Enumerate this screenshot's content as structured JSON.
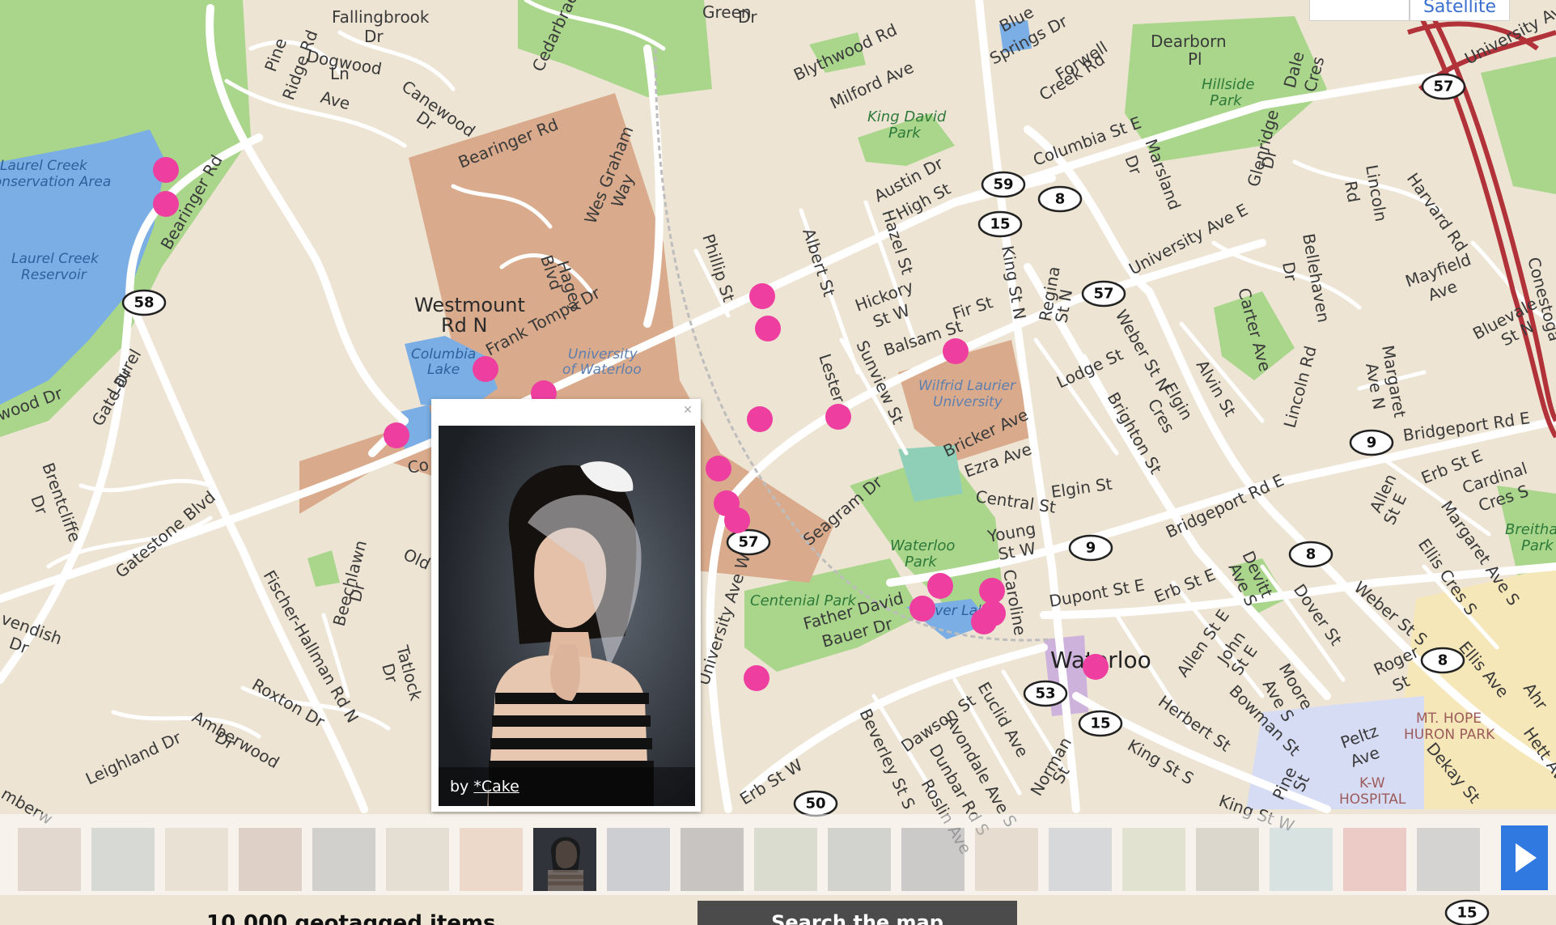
{
  "map_toggle": {
    "map_label": "",
    "satellite_label": "Satellite"
  },
  "streets": {
    "fallingbrook_1": "Fallingbrook",
    "fallingbrook_2": "Dr",
    "pine_ridge_1": "Pine",
    "pine_ridge_2": "Ridge Rd",
    "dogwood_1": "Dogwood",
    "dogwood_2": "Ln",
    "ave_1": "Ave",
    "cedarbrae": "Cedarbrae",
    "canewood_1": "Canewood",
    "canewood_2": "Dr",
    "bearinger_rd_1": "Bearinger Rd",
    "bearinger_rd_2": "Bearinger Rd",
    "wes_graham_1": "Wes Graham",
    "wes_graham_2": "Way",
    "hagey_1": "Hagey",
    "hagey_2": "Blvd",
    "westmount_1": "Westmount",
    "westmount_2": "Rd N",
    "frank_tompa": "Frank Tompa Dr",
    "green_1": "Green",
    "green_2": "Dr",
    "blythwood": "Blythwood Rd",
    "milford": "Milford Ave",
    "blue_springs_1": "Blue",
    "blue_springs_2": "Springs Dr",
    "forwell_1": "Forwell",
    "forwell_2": "Creek Rd",
    "dearborn_1": "Dearborn",
    "dearborn_2": "Pl",
    "university_ave_ne": "University Ave",
    "columbia_st_e": "Columbia St E",
    "austin_1": "Austin Dr",
    "high_st": "High St",
    "phillip_st": "Phillip St",
    "albert_st": "Albert St",
    "hazel_st": "Hazel St",
    "king_st_n": "King St N",
    "marsland_1": "Marsland",
    "marsland_2": "Dr",
    "dale_1": "Dale",
    "dale_2": "Cres",
    "glenridge_1": "Glenridge",
    "glenridge_2": "Dr",
    "lincoln_rd_n_1": "Lincoln",
    "lincoln_rd_n_2": "Rd",
    "harvard_1": "Harvard Rd",
    "university_ave_e": "University Ave E",
    "bellehaven_1": "Bellehaven",
    "bellehaven_2": "Dr",
    "mayfield_1": "Mayfield",
    "mayfield_2": "Ave",
    "bluevale_1": "Bluevale",
    "bluevale_2": "St N",
    "conestoga": "Conestoga",
    "hickory_1": "Hickory",
    "hickory_2": "St W",
    "fir_st": "Fir St",
    "balsam_st": "Balsam St",
    "regina_1": "Regina",
    "regina_2": "St N",
    "weber_st_n": "Weber St N",
    "lodge_st": "Lodge St",
    "carter_ave": "Carter Ave",
    "alvin_st": "Alvin St",
    "lincoln_rd": "Lincoln Rd",
    "margaret_1": "Margaret",
    "margaret_2": "Ave N",
    "lester_st": "Lester St",
    "sunview_st": "Sunview St",
    "elgin_1": "Elgin",
    "elgin_2": "Cres",
    "brighton_st": "Brighton St",
    "bricker_ave": "Bricker Ave",
    "ezra_ave": "Ezra Ave",
    "bridgeport_rd_e_1": "Bridgeport Rd E",
    "bridgeport_rd_e_2": "Bridgeport Rd E",
    "central_st": "Central St",
    "elgin_st": "Elgin St",
    "seagram_dr": "Seagram Dr",
    "young_1": "Young",
    "young_2": "St W",
    "erb_st_e_1": "Erb St E",
    "erb_st_e_2": "Erb St E",
    "cardinal_1": "Cardinal",
    "cardinal_2": "Cres S",
    "allen_st_e_1": "Allen",
    "allen_st_e_2": "St E",
    "margaret_ave_s": "Margaret Ave S",
    "ellis_cres_s": "Ellis Cres S",
    "dover_st": "Dover St",
    "devitt_1": "Devitt",
    "devitt_2": "Ave S",
    "dupont_st_e": "Dupont St E",
    "caroline": "Caroline",
    "weber_st_s": "Weber St S",
    "ellis_ave": "Ellis Ave",
    "laurel_gate_1": "Laurel",
    "laurel_gate_2": "Gate Dr",
    "wood_dr": "wood Dr",
    "brentcliffe_1": "Brentcliffe",
    "brentcliffe_2": "Dr",
    "gatestone": "Gatestone Blvd",
    "old": "Old",
    "co": "Co",
    "beechlawn_1": "Beechlawn",
    "beechlawn_2": "Dr",
    "fischer_hallman": "Fischer-Hallman Rd N",
    "vendish_1": "vendish",
    "vendish_2": "Dr",
    "tatlock_1": "Tatlock",
    "tatlock_2": "Dr",
    "roxton": "Roxton Dr",
    "amberwood_1": "Amberwood",
    "amberwood_2": "Dr",
    "leighland": "Leighland Dr",
    "mberw": "mberw",
    "university_ave_w": "University Ave W",
    "father_david_1": "Father David",
    "father_david_2": "Bauer Dr",
    "allen_st_e_3": "Allen St E",
    "john_1": "John",
    "john_2": "St E",
    "moore_1": "Moore",
    "moore_2": "Ave S",
    "roger_1": "Roger",
    "roger_2": "St",
    "herbert_st": "Herbert St",
    "bowman_st": "Bowman St",
    "peltz_1": "Peltz",
    "peltz_2": "Ave",
    "dekay_st": "Dekay St",
    "beverley": "Beverley St S",
    "dawson_st": "Dawson St",
    "avondale_ave_s": "Avondale Ave S",
    "euclid_ave": "Euclid Ave",
    "dunbar_rd_s": "Dunbar Rd S",
    "roslin": "Roslin Ave",
    "norman_1": "Norman",
    "norman_2": "St",
    "king_st_s": "King St S",
    "pine_1": "Pine",
    "pine_2": "St",
    "king_st_w": "King St W",
    "erb_st_w": "Erb St W",
    "hett_ave": "Hett Ave",
    "ahr": "Ahr"
  },
  "areas": {
    "laurel_creek_1": "Laurel Creek",
    "laurel_creek_2": "Conservation Area",
    "laurel_res_1": "Laurel Creek",
    "laurel_res_2": "Reservoir",
    "columbia_lake_1": "Columbia",
    "columbia_lake_2": "Lake",
    "uw_1": "University",
    "uw_2": "of Waterloo",
    "king_david_1": "King David",
    "king_david_2": "Park",
    "hillside_1": "Hillside",
    "hillside_2": "Park",
    "laurier_1": "Wilfrid Laurier",
    "laurier_2": "University",
    "waterloo_park_1": "Waterloo",
    "waterloo_park_2": "Park",
    "centennial_park": "Centenial Park",
    "silver_lake": "Silver Lake",
    "breithaupt_1": "Breithau",
    "breithaupt_2": "Park",
    "mt_hope_1": "MT. HOPE",
    "mt_hope_2": "HURON PARK",
    "kw_hospital_1": "K-W",
    "kw_hospital_2": "HOSPITAL",
    "city": "Waterloo"
  },
  "shields": [
    "58",
    "59",
    "8",
    "15",
    "57",
    "57",
    "57",
    "9",
    "9",
    "8",
    "8",
    "53",
    "15",
    "50",
    "15"
  ],
  "popup": {
    "caption_prefix": "by",
    "author": "*Cake",
    "close_icon": "close-icon"
  },
  "filmstrip": {
    "count": 20,
    "active_index": 7,
    "next_icon": "play-arrow-icon"
  },
  "bottom": {
    "geotag_count": "10,000 geotagged items",
    "search_button": "Search the map"
  },
  "colors": {
    "land": "#ede4d4",
    "park": "#a9d68b",
    "water": "#7aaee4",
    "campus": "#d9ab8c",
    "pin": "#ee3fa0",
    "highway": "#b2323a",
    "next_button": "#2f79e0"
  }
}
